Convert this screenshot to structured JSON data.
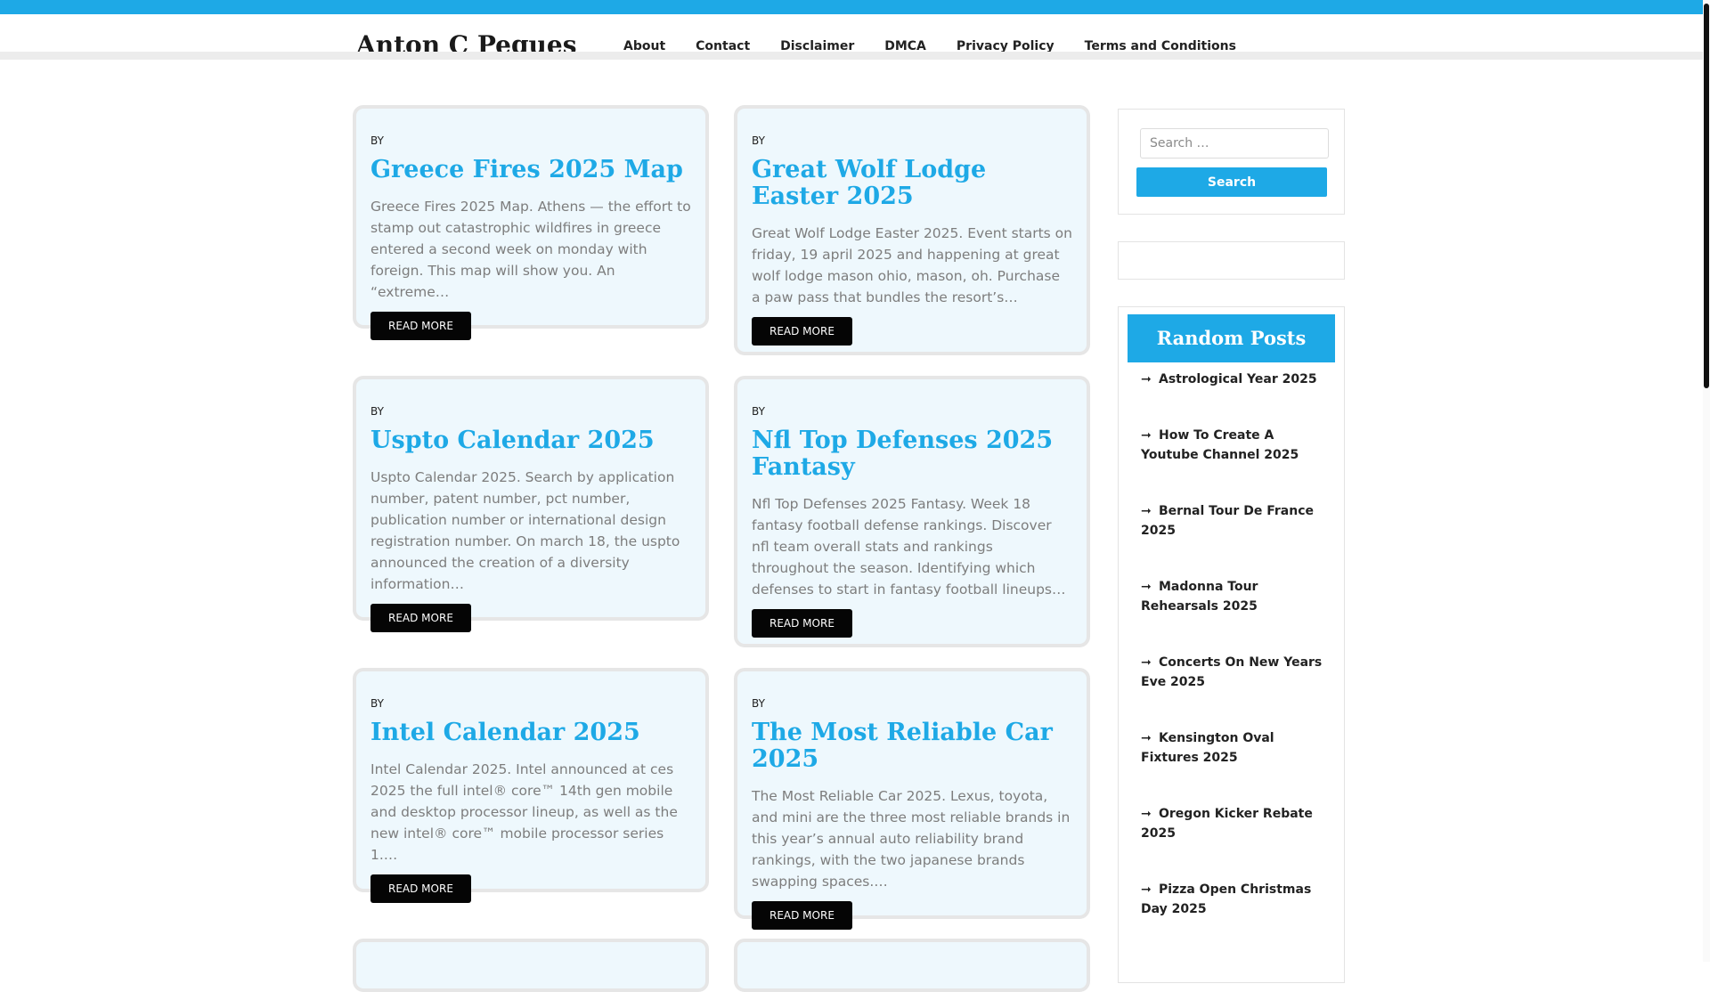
{
  "site": {
    "title": "Anton C Pegues"
  },
  "nav": [
    "About",
    "Contact",
    "Disclaimer",
    "DMCA",
    "Privacy Policy",
    "Terms and Conditions"
  ],
  "posts": [
    {
      "by": "BY",
      "title": "Greece Fires 2025 Map",
      "excerpt": "Greece Fires 2025 Map. Athens — the effort to stamp out catastrophic wildfires in greece entered a second week on monday with foreign. This map will show you. An “extreme…",
      "read_more": "READ MORE"
    },
    {
      "by": "BY",
      "title": "Great Wolf Lodge Easter 2025",
      "excerpt": "Great Wolf Lodge Easter 2025. Event starts on friday, 19 april 2025 and happening at great wolf lodge mason ohio, mason, oh. Purchase a paw pass that bundles the resort’s…",
      "read_more": "READ MORE"
    },
    {
      "by": "BY",
      "title": "Uspto Calendar 2025",
      "excerpt": "Uspto Calendar 2025. Search by application number, patent number, pct number, publication number or international design registration number. On march 18, the uspto announced the creation of a diversity information…",
      "read_more": "READ MORE"
    },
    {
      "by": "BY",
      "title": "Nfl Top Defenses 2025 Fantasy",
      "excerpt": "Nfl Top Defenses 2025 Fantasy. Week 18 fantasy football defense rankings. Discover nfl team overall stats and rankings throughout the season. Identifying which defenses to start in fantasy football lineups…",
      "read_more": "READ MORE"
    },
    {
      "by": "BY",
      "title": "Intel Calendar 2025",
      "excerpt": "Intel Calendar 2025. Intel announced at ces 2025 the full intel® core™ 14th gen mobile and desktop processor lineup, as well as the new intel® core™ mobile processor series 1.…",
      "read_more": "READ MORE"
    },
    {
      "by": "BY",
      "title": "The Most Reliable Car 2025",
      "excerpt": "The Most Reliable Car 2025. Lexus, toyota, and mini are the three most reliable brands in this year’s annual auto reliability brand rankings, with the two japanese brands swapping spaces.…",
      "read_more": "READ MORE"
    }
  ],
  "search": {
    "placeholder": "Search …",
    "button": "Search"
  },
  "random_posts": {
    "heading": "Random Posts",
    "items": [
      "Astrological Year 2025",
      "How To Create A Youtube Channel 2025",
      "Bernal Tour De France 2025",
      "Madonna Tour Rehearsals 2025",
      "Concerts On New Years Eve 2025",
      "Kensington Oval Fixtures 2025",
      "Oregon Kicker Rebate 2025",
      "Pizza Open Christmas Day 2025"
    ]
  },
  "icons": {
    "list_arrow": "arrow-right-icon"
  },
  "colors": {
    "accent": "#1ea9e6",
    "card_bg": "#eef8fd",
    "button_dark": "#050505"
  }
}
